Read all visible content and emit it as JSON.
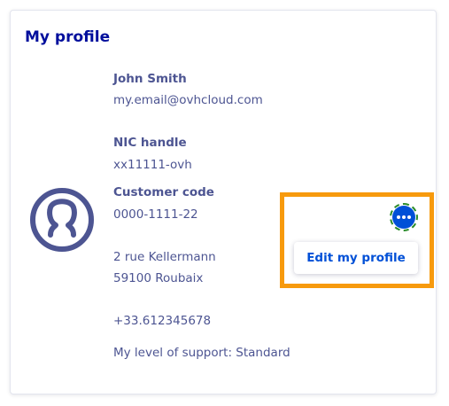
{
  "card": {
    "title": "My profile"
  },
  "profile": {
    "name": "John Smith",
    "email": "my.email@ovhcloud.com",
    "nic_label": "NIC handle",
    "nic_value": "xx11111-ovh",
    "customer_code_label": "Customer code",
    "customer_code_value": "0000-1111-22",
    "address_line1": "2 rue Kellermann",
    "address_line2": "59100 Roubaix",
    "phone": "+33.612345678",
    "support_level": "My level of support: Standard"
  },
  "actions": {
    "menu_icon": "ellipsis-icon",
    "edit_label": "Edit my profile"
  },
  "colors": {
    "title": "#000e9c",
    "text": "#4d5592",
    "accent": "#0050d7",
    "highlight": "#f79a0d",
    "focus_ring": "#2a8b2a"
  }
}
